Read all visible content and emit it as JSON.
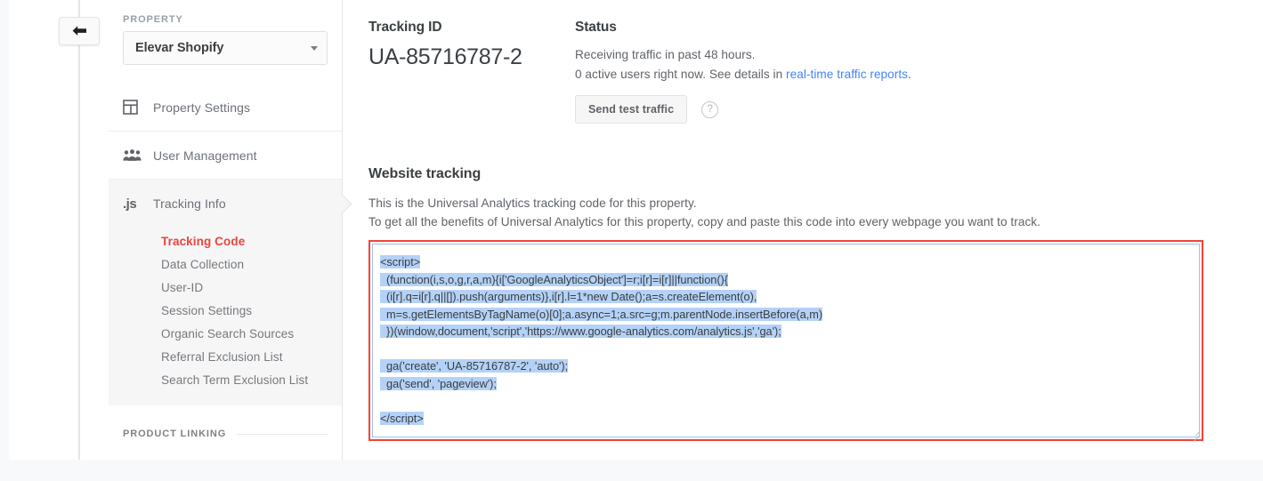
{
  "nav_rail": {
    "back_button_label": "Back"
  },
  "sidebar": {
    "property_section_label": "PROPERTY",
    "property_selected": "Elevar Shopify",
    "items": [
      {
        "label": "Property Settings",
        "icon": "property-settings-icon",
        "active": false
      },
      {
        "label": "User Management",
        "icon": "user-management-icon",
        "active": false
      },
      {
        "label": "Tracking Info",
        "icon": "js-icon",
        "active": true
      }
    ],
    "subitems": [
      {
        "label": "Tracking Code",
        "selected": true
      },
      {
        "label": "Data Collection",
        "selected": false
      },
      {
        "label": "User-ID",
        "selected": false
      },
      {
        "label": "Session Settings",
        "selected": false
      },
      {
        "label": "Organic Search Sources",
        "selected": false
      },
      {
        "label": "Referral Exclusion List",
        "selected": false
      },
      {
        "label": "Search Term Exclusion List",
        "selected": false
      }
    ],
    "product_linking_label": "PRODUCT LINKING"
  },
  "main": {
    "tracking_id_heading": "Tracking ID",
    "tracking_id_value": "UA-85716787-2",
    "status_heading": "Status",
    "status_line_1": "Receiving traffic in past 48 hours.",
    "status_line_2_prefix": "0 active users right now. See details in ",
    "status_link_text": "real-time traffic reports",
    "status_line_2_suffix": ".",
    "send_test_traffic_label": "Send test traffic",
    "help_icon_glyph": "?",
    "website_tracking_heading": "Website tracking",
    "website_tracking_desc_1": "This is the Universal Analytics tracking code for this property.",
    "website_tracking_desc_2": "To get all the benefits of Universal Analytics for this property, copy and paste this code into every webpage you want to track.",
    "code_lines": [
      "<script>",
      "  (function(i,s,o,g,r,a,m){i['GoogleAnalyticsObject']=r;i[r]=i[r]||function(){",
      "  (i[r].q=i[r].q||[]).push(arguments)},i[r].l=1*new Date();a=s.createElement(o),",
      "  m=s.getElementsByTagName(o)[0];a.async=1;a.src=g;m.parentNode.insertBefore(a,m)",
      "  })(window,document,'script','https://www.google-analytics.com/analytics.js','ga');",
      "",
      "  ga('create', 'UA-85716787-2', 'auto');",
      "  ga('send', 'pageview');",
      "",
      "</script>"
    ]
  },
  "colors": {
    "accent_red": "#e8453c",
    "highlight_border": "#f44336",
    "link_blue": "#4285f4",
    "selection_blue": "#b4d2f7",
    "textarea_border": "#a4c0ea"
  }
}
